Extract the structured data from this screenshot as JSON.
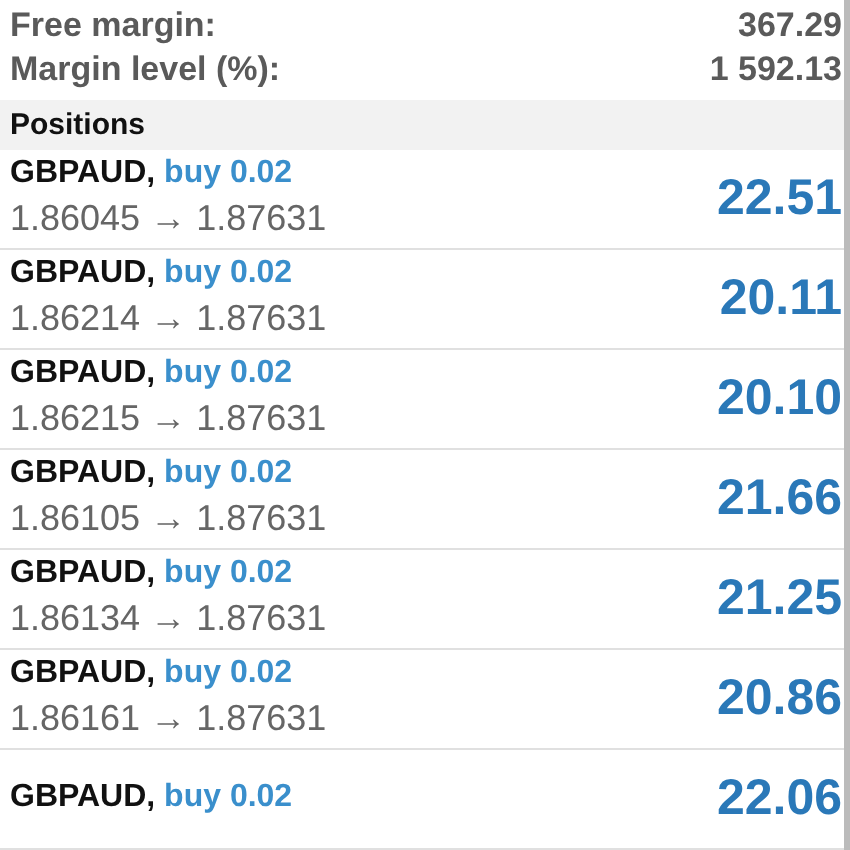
{
  "summary": [
    {
      "label": "Free margin:",
      "value": "367.29"
    },
    {
      "label": "Margin level (%):",
      "value": "1 592.13"
    }
  ],
  "positions_header": "Positions",
  "positions": [
    {
      "symbol": "GBPAUD,",
      "order": "buy 0.02",
      "prices": "1.86045 → 1.87631",
      "profit": "22.51"
    },
    {
      "symbol": "GBPAUD,",
      "order": "buy 0.02",
      "prices": "1.86214 → 1.87631",
      "profit": "20.11"
    },
    {
      "symbol": "GBPAUD,",
      "order": "buy 0.02",
      "prices": "1.86215 → 1.87631",
      "profit": "20.10"
    },
    {
      "symbol": "GBPAUD,",
      "order": "buy 0.02",
      "prices": "1.86105 → 1.87631",
      "profit": "21.66"
    },
    {
      "symbol": "GBPAUD,",
      "order": "buy 0.02",
      "prices": "1.86134 → 1.87631",
      "profit": "21.25"
    },
    {
      "symbol": "GBPAUD,",
      "order": "buy 0.02",
      "prices": "1.86161 → 1.87631",
      "profit": "20.86"
    },
    {
      "symbol": "GBPAUD,",
      "order": "buy 0.02",
      "profit": "22.06"
    }
  ]
}
